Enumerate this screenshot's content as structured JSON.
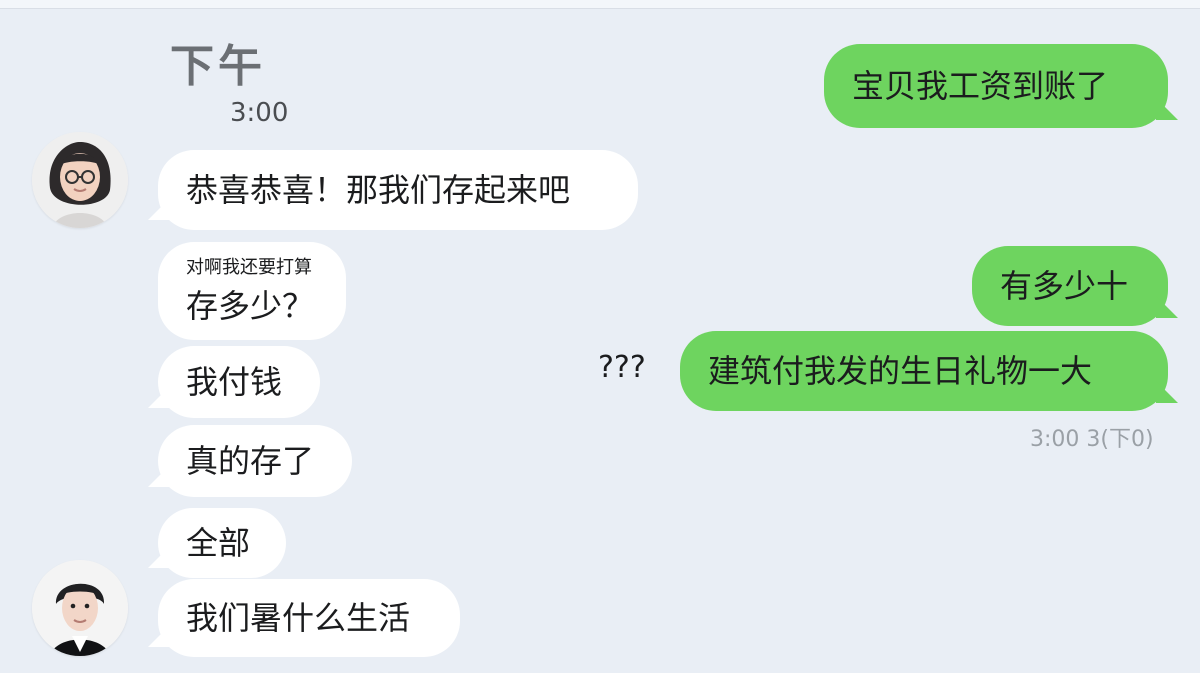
{
  "header": {
    "title": "下午",
    "time": "3:00"
  },
  "messages": {
    "left": [
      {
        "text": "恭喜恭喜！那我们存起来吧"
      },
      {
        "small": "对啊我还要打算",
        "text": "存多少？"
      },
      {
        "text": "我付钱"
      },
      {
        "text": "真的存了"
      },
      {
        "text": "全部"
      },
      {
        "text": "我们暑什么生活"
      }
    ],
    "right": [
      {
        "text": "宝贝我工资到账了"
      },
      {
        "text": "有多少十"
      },
      {
        "text": "建筑付我发的生日礼物一大"
      }
    ]
  },
  "aside": {
    "questions": "???",
    "time": "3:00 3(下0)"
  },
  "colors": {
    "background": "#e9eef5",
    "bubble_left": "#ffffff",
    "bubble_right": "#6ed45f"
  },
  "icons": {
    "avatar_1": "female-avatar-icon",
    "avatar_2": "male-avatar-icon"
  }
}
